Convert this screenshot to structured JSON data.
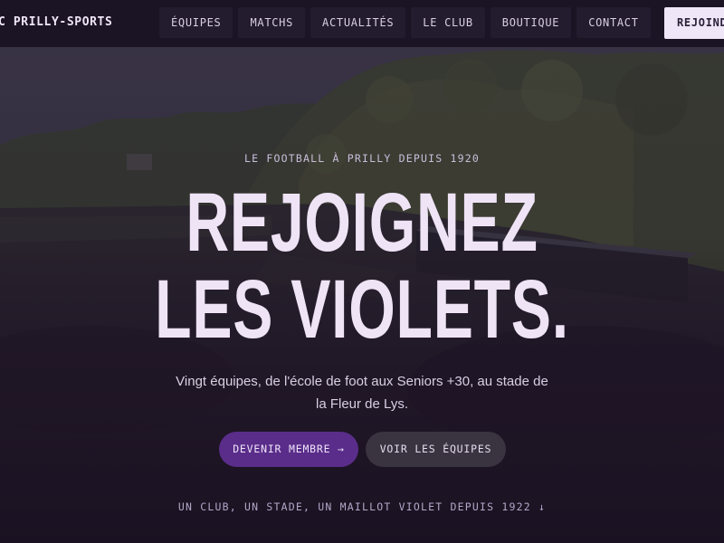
{
  "brand": {
    "name": "C PRILLY-SPORTS"
  },
  "nav": {
    "items": [
      {
        "label": "ÉQUIPES"
      },
      {
        "label": "MATCHS"
      },
      {
        "label": "ACTUALITÉS"
      },
      {
        "label": "LE CLUB"
      },
      {
        "label": "BOUTIQUE"
      },
      {
        "label": "CONTACT"
      }
    ],
    "cta_label": "REJOIND"
  },
  "hero": {
    "eyebrow": "LE FOOTBALL À PRILLY DEPUIS 1920",
    "title_line1": "REJOIGNEZ",
    "title_line2": "LES VIOLETS.",
    "subtitle": "Vingt équipes, de l'école de foot aux Seniors +30, au stade de la Fleur de Lys.",
    "primary_button": "DEVENIR MEMBRE →",
    "secondary_button": "VOIR LES ÉQUIPES",
    "tagline": "UN CLUB, UN STADE, UN MAILLOT VIOLET DEPUIS 1922 ↓"
  },
  "colors": {
    "accent": "#5a2d8a",
    "title_text": "#efe3f6",
    "nav_background": "#1b1425",
    "cta_background": "#efe6f7"
  }
}
